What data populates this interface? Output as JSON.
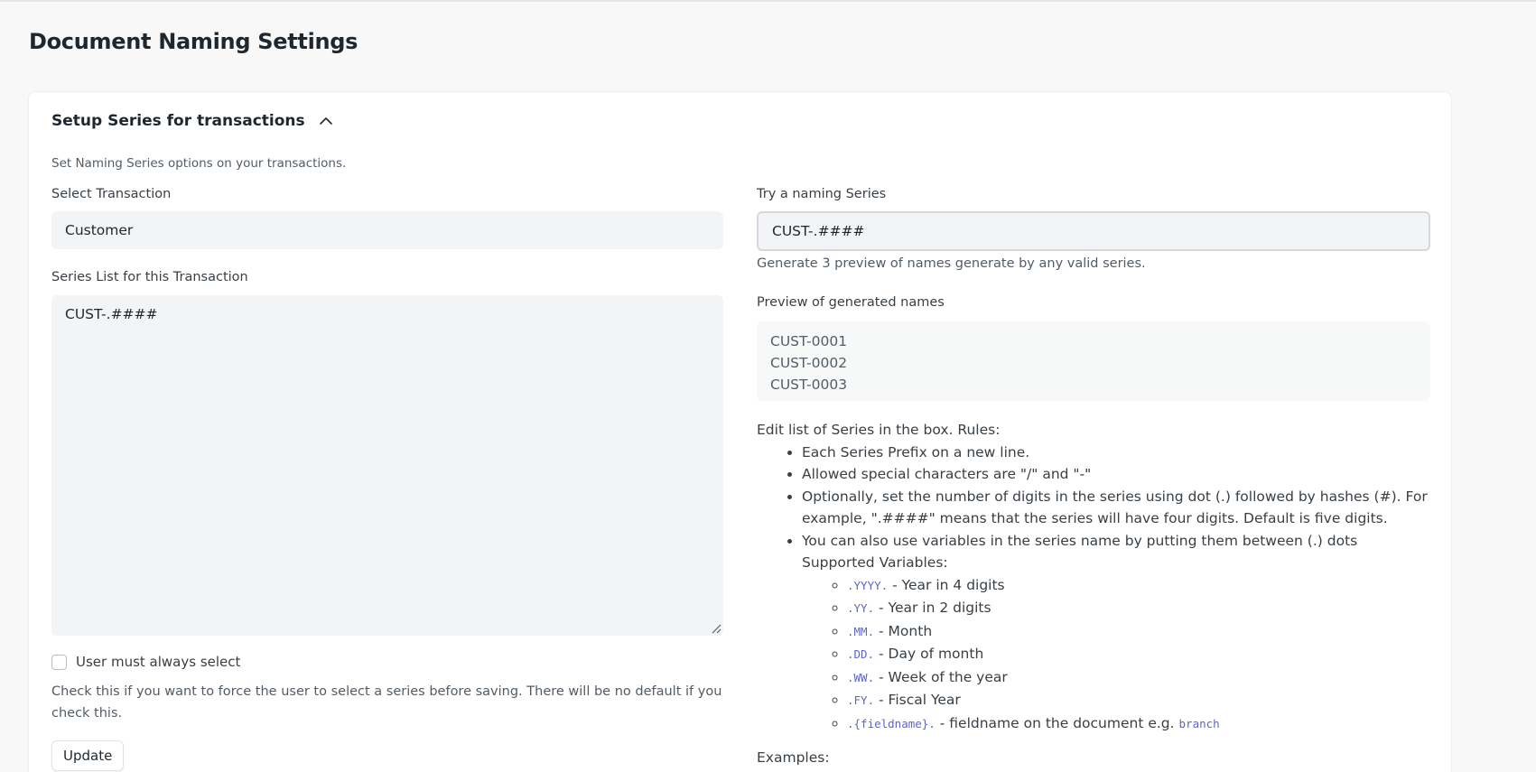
{
  "page": {
    "title": "Document Naming Settings"
  },
  "section": {
    "title": "Setup Series for transactions",
    "description": "Set Naming Series options on your transactions."
  },
  "transaction": {
    "label": "Select Transaction",
    "value": "Customer"
  },
  "series_list": {
    "label": "Series List for this Transaction",
    "value": "CUST-.####"
  },
  "user_must_select": {
    "label": "User must always select",
    "checked": false,
    "description": "Check this if you want to force the user to select a series before saving. There will be no default if you check this."
  },
  "update_button": {
    "label": "Update"
  },
  "try_series": {
    "label": "Try a naming Series",
    "value": "CUST-.####",
    "description": "Generate 3 preview of names generate by any valid series."
  },
  "preview": {
    "label": "Preview of generated names",
    "names": [
      "CUST-0001",
      "CUST-0002",
      "CUST-0003"
    ]
  },
  "rules": {
    "intro": "Edit list of Series in the box. Rules:",
    "items": [
      "Each Series Prefix on a new line.",
      "Allowed special characters are \"/\" and \"-\"",
      "Optionally, set the number of digits in the series using dot (.) followed by hashes (#). For example, \".####\" means that the series will have four digits. Default is five digits."
    ],
    "variables_intro_1": "You can also use variables in the series name by putting them between (.) dots",
    "variables_intro_2": "Supported Variables:",
    "variables": [
      {
        "code": ".YYYY.",
        "desc": " - Year in 4 digits"
      },
      {
        "code": ".YY.",
        "desc": " - Year in 2 digits"
      },
      {
        "code": ".MM.",
        "desc": " - Month"
      },
      {
        "code": ".DD.",
        "desc": " - Day of month"
      },
      {
        "code": ".WW.",
        "desc": " - Week of the year"
      },
      {
        "code": ".FY.",
        "desc": " - Fiscal Year"
      },
      {
        "code": ".{fieldname}.",
        "desc": " - fieldname on the document e.g. ",
        "example": "branch"
      }
    ],
    "examples_label": "Examples:"
  },
  "icons": {
    "collapse": "chevron-up-icon",
    "resize": "resize-grip-icon"
  },
  "colors": {
    "code": "#5e64c9",
    "input_bg": "#f3f4f5",
    "page_bg": "#f8f8f8"
  }
}
